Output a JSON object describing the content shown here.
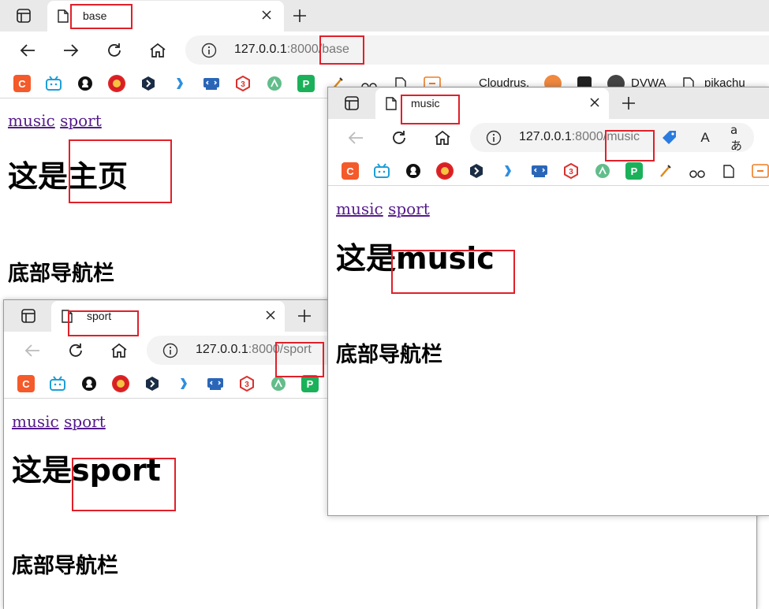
{
  "windows": {
    "base": {
      "tab_title": "base",
      "url_host": "127.0.0.1",
      "url_port": ":8000",
      "url_path": "/base",
      "links": [
        "music",
        "sport"
      ],
      "heading_prefix": "这是",
      "heading_highlight": "主页",
      "footer": "底部导航栏",
      "bookmarks_text": [
        "Cloudrus.",
        "DVWA",
        "pikachu"
      ]
    },
    "music": {
      "tab_title": "music",
      "url_host": "127.0.0.1",
      "url_port": ":8000",
      "url_path": "/music",
      "links": [
        "music",
        "sport"
      ],
      "heading_prefix": "这是",
      "heading_highlight": "music",
      "footer": "底部导航栏",
      "toolbar_extra": [
        "A",
        "aあ"
      ]
    },
    "sport": {
      "tab_title": "sport",
      "url_host": "127.0.0.1",
      "url_port": ":8000",
      "url_path": "/sport",
      "links": [
        "music",
        "sport"
      ],
      "heading_prefix": "这是",
      "heading_highlight": "sport",
      "footer": "底部导航栏"
    }
  },
  "icons": [
    "sidebar-icon",
    "doc-icon",
    "close-icon",
    "plus-icon",
    "back-icon",
    "forward-icon",
    "refresh-icon",
    "home-icon",
    "info-icon",
    "tag-icon",
    "read-aloud-icon",
    "translate-icon"
  ],
  "colors": {
    "highlight": "#e0202a",
    "link": "#551a8b",
    "tabbar": "#e9e9e9"
  }
}
